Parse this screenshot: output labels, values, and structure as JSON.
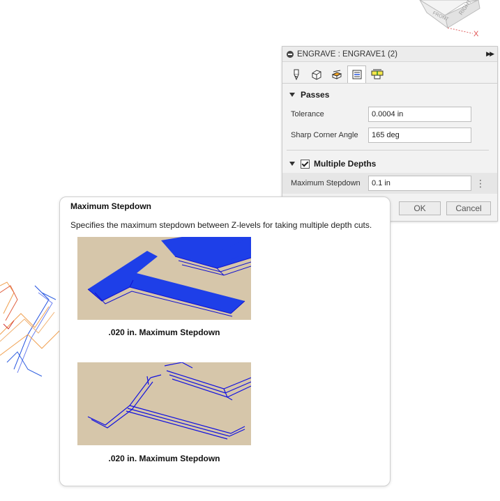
{
  "viewcube": {
    "face_label": "RIGHT",
    "front_label": "FRONT",
    "axis_x": "X"
  },
  "panel": {
    "title": "ENGRAVE : ENGRAVE1 (2)",
    "tabs": [
      {
        "icon": "tool-icon"
      },
      {
        "icon": "geometry-icon"
      },
      {
        "icon": "heights-icon"
      },
      {
        "icon": "passes-icon",
        "active": true
      },
      {
        "icon": "linking-icon"
      }
    ],
    "passes": {
      "title": "Passes",
      "tolerance_label": "Tolerance",
      "tolerance_value": "0.0004 in",
      "sharp_corner_label": "Sharp Corner Angle",
      "sharp_corner_value": "165 deg"
    },
    "multiple_depths": {
      "title": "Multiple Depths",
      "checked": true,
      "max_stepdown_label": "Maximum Stepdown",
      "max_stepdown_value": "0.1 in"
    },
    "ok_label": "OK",
    "cancel_label": "Cancel"
  },
  "tooltip": {
    "title": "Maximum Stepdown",
    "description": "Specifies the maximum stepdown between Z-levels for taking multiple depth cuts.",
    "caption_1": ".020 in. Maximum Stepdown",
    "caption_2": ".020 in. Maximum Stepdown"
  },
  "colors": {
    "toolpath_blue": "#1f1fe0",
    "toolpath_orange": "#f0a050",
    "stock_tan": "#d6c6aa"
  }
}
